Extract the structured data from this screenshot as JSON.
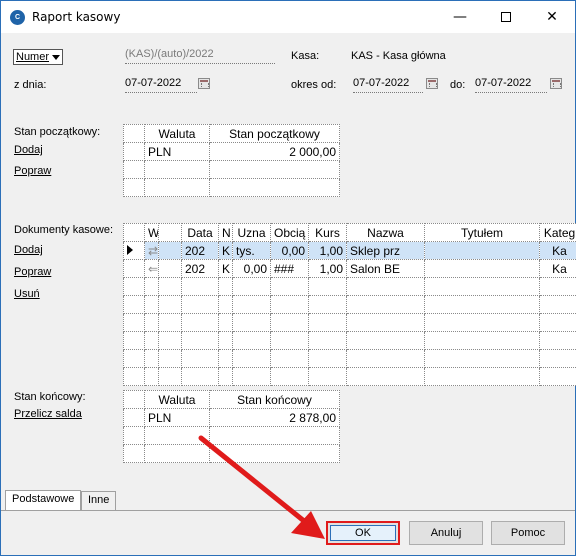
{
  "window": {
    "title": "Raport kasowy",
    "min": "—",
    "close": "✕"
  },
  "header": {
    "numer_label": "Numer",
    "numer_value": "(KAS)/(auto)/2022",
    "kasa_label": "Kasa:",
    "kasa_value": "KAS - Kasa główna",
    "z_dnia_label": "z dnia:",
    "z_dnia_value": "07-07-2022",
    "okres_od_label": "okres od:",
    "okres_od_value": "07-07-2022",
    "do_label": "do:",
    "do_value": "07-07-2022"
  },
  "stan_poczatkowy": {
    "section_label": "Stan początkowy:",
    "links": [
      "Dodaj",
      "Popraw"
    ],
    "columns": [
      "Waluta",
      "Stan początkowy"
    ],
    "rows": [
      {
        "waluta": "PLN",
        "stan": "2 000,00"
      }
    ]
  },
  "dokumenty": {
    "section_label": "Dokumenty kasowe:",
    "links": [
      "Dodaj",
      "Popraw",
      "Usuń"
    ],
    "columns": [
      "W",
      "Data",
      "N",
      "Uzna",
      "Obcią",
      "Kurs",
      "Nazwa",
      "Tytułem",
      "Kateg"
    ],
    "rows": [
      {
        "data": "202",
        "n": "K",
        "uzna": "tys.",
        "obcia": "0,00",
        "kurs": "1,00",
        "nazwa": "Sklep prz",
        "tytulem": "",
        "kateg": "Ka"
      },
      {
        "data": "202",
        "n": "K",
        "uzna": "0,00",
        "obcia": "###",
        "kurs": "1,00",
        "nazwa": "Salon BE",
        "tytulem": "",
        "kateg": "Ka"
      }
    ]
  },
  "stan_koncowy": {
    "section_label": "Stan końcowy:",
    "link": "Przelicz salda",
    "columns": [
      "Waluta",
      "Stan końcowy"
    ],
    "rows": [
      {
        "waluta": "PLN",
        "stan": "2 878,00"
      }
    ]
  },
  "tabs": [
    "Podstawowe",
    "Inne"
  ],
  "buttons": {
    "ok": "OK",
    "anuluj": "Anuluj",
    "pomoc": "Pomoc"
  },
  "colors": {
    "annotation_red": "#e01b1b",
    "selected_row": "#cfe3f7",
    "title_accent": "#1f63a8"
  }
}
